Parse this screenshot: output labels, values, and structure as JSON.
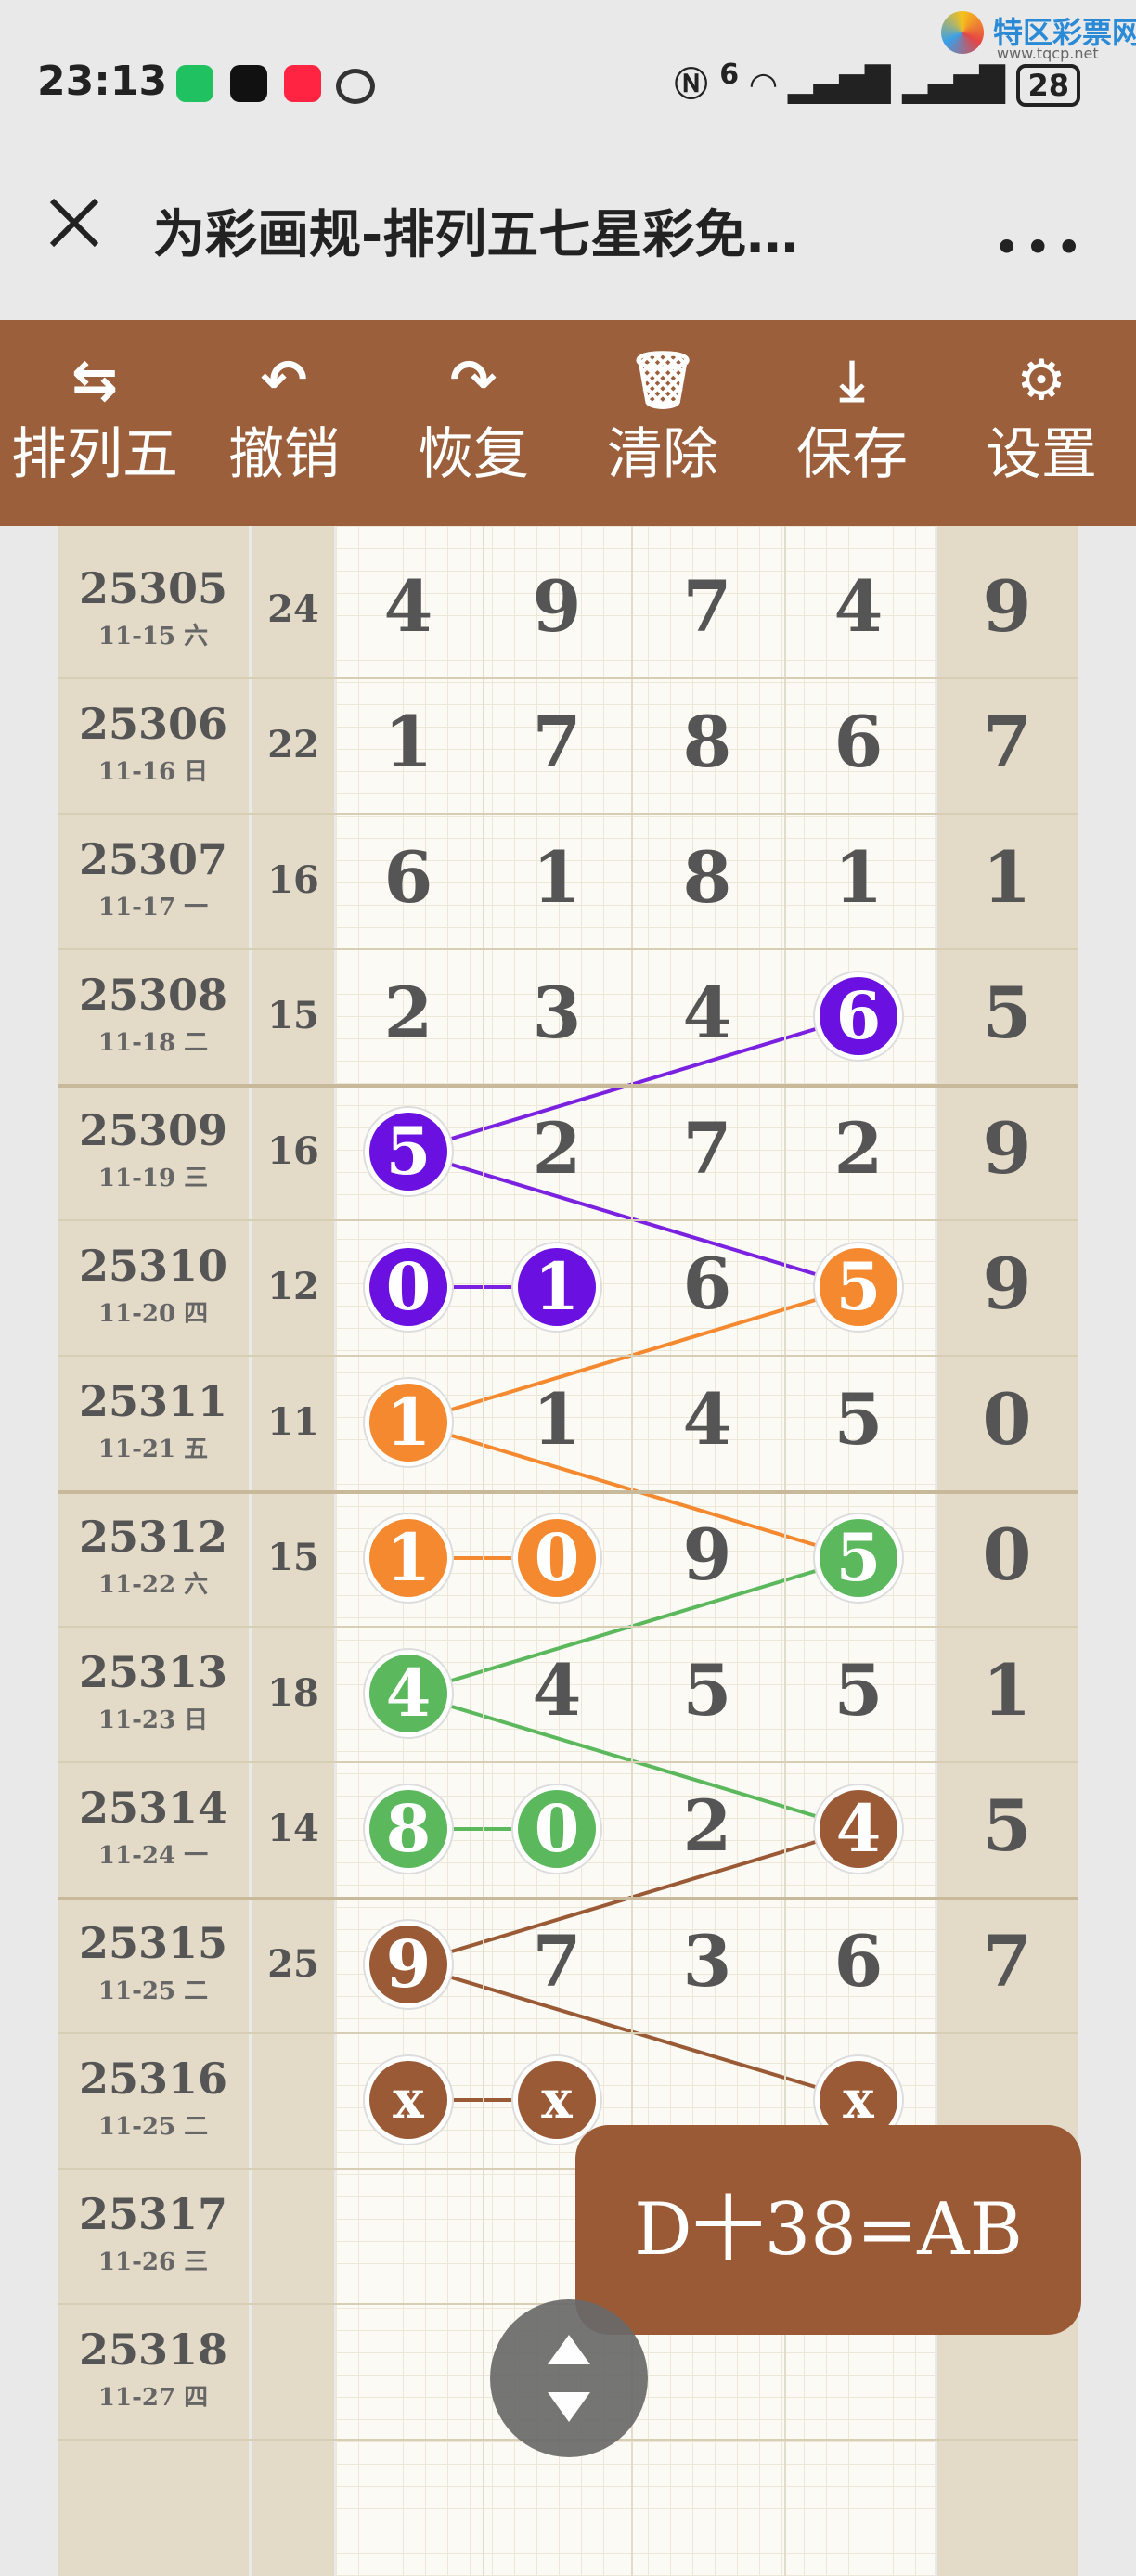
{
  "status": {
    "time": "23:13",
    "battery": "28",
    "network": "6"
  },
  "watermark": {
    "title": "特区彩票网",
    "url": "www.tqcp.net"
  },
  "header": {
    "title": "为彩画规-排列五七星彩免…",
    "more": "•••"
  },
  "toolbar": {
    "items": [
      {
        "label": "排列五",
        "icon": "swap-icon"
      },
      {
        "label": "撤销",
        "icon": "undo-icon"
      },
      {
        "label": "恢复",
        "icon": "redo-icon"
      },
      {
        "label": "清除",
        "icon": "trash-icon"
      },
      {
        "label": "保存",
        "icon": "download-icon"
      },
      {
        "label": "设置",
        "icon": "gear-icon"
      }
    ]
  },
  "rows": [
    {
      "issue": "25305",
      "date": "11-15 六",
      "sum": "24",
      "digits": [
        "4",
        "9",
        "7",
        "4"
      ],
      "tail": "9"
    },
    {
      "issue": "25306",
      "date": "11-16 日",
      "sum": "22",
      "digits": [
        "1",
        "7",
        "8",
        "6"
      ],
      "tail": "7"
    },
    {
      "issue": "25307",
      "date": "11-17 一",
      "sum": "16",
      "digits": [
        "6",
        "1",
        "8",
        "1"
      ],
      "tail": "1"
    },
    {
      "issue": "25308",
      "date": "11-18 二",
      "sum": "15",
      "digits": [
        "2",
        "3",
        "4",
        "6"
      ],
      "tail": "5"
    },
    {
      "issue": "25309",
      "date": "11-19 三",
      "sum": "16",
      "digits": [
        "5",
        "2",
        "7",
        "2"
      ],
      "tail": "9"
    },
    {
      "issue": "25310",
      "date": "11-20 四",
      "sum": "12",
      "digits": [
        "0",
        "1",
        "6",
        "5"
      ],
      "tail": "9"
    },
    {
      "issue": "25311",
      "date": "11-21 五",
      "sum": "11",
      "digits": [
        "1",
        "1",
        "4",
        "5"
      ],
      "tail": "0"
    },
    {
      "issue": "25312",
      "date": "11-22 六",
      "sum": "15",
      "digits": [
        "1",
        "0",
        "9",
        "5"
      ],
      "tail": "0"
    },
    {
      "issue": "25313",
      "date": "11-23 日",
      "sum": "18",
      "digits": [
        "4",
        "4",
        "5",
        "5"
      ],
      "tail": "1"
    },
    {
      "issue": "25314",
      "date": "11-24 一",
      "sum": "14",
      "digits": [
        "8",
        "0",
        "2",
        "4"
      ],
      "tail": "5"
    },
    {
      "issue": "25315",
      "date": "11-25 二",
      "sum": "25",
      "digits": [
        "9",
        "7",
        "3",
        "6"
      ],
      "tail": "7"
    },
    {
      "issue": "25316",
      "date": "11-25 二",
      "sum": "",
      "digits": [
        "x",
        "x",
        "",
        "x"
      ],
      "tail": ""
    },
    {
      "issue": "25317",
      "date": "11-26 三",
      "sum": "",
      "digits": [
        "",
        "",
        "",
        ""
      ],
      "tail": ""
    },
    {
      "issue": "25318",
      "date": "11-27 四",
      "sum": "",
      "digits": [
        "",
        "",
        "",
        ""
      ],
      "tail": ""
    }
  ],
  "marks": [
    {
      "row": 3,
      "col": 3,
      "color": "#6a10e0"
    },
    {
      "row": 4,
      "col": 0,
      "color": "#6a10e0"
    },
    {
      "row": 5,
      "col": 0,
      "color": "#6a10e0"
    },
    {
      "row": 5,
      "col": 1,
      "color": "#6a10e0"
    },
    {
      "row": 5,
      "col": 3,
      "color": "#f5892f"
    },
    {
      "row": 6,
      "col": 0,
      "color": "#f5892f"
    },
    {
      "row": 7,
      "col": 0,
      "color": "#f5892f"
    },
    {
      "row": 7,
      "col": 1,
      "color": "#f5892f"
    },
    {
      "row": 7,
      "col": 3,
      "color": "#5cb85c"
    },
    {
      "row": 8,
      "col": 0,
      "color": "#5cb85c"
    },
    {
      "row": 9,
      "col": 0,
      "color": "#5cb85c"
    },
    {
      "row": 9,
      "col": 1,
      "color": "#5cb85c"
    },
    {
      "row": 9,
      "col": 3,
      "color": "#9b5a36"
    },
    {
      "row": 10,
      "col": 0,
      "color": "#9b5a36"
    },
    {
      "row": 11,
      "col": 0,
      "color": "#9b5a36"
    },
    {
      "row": 11,
      "col": 1,
      "color": "#9b5a36"
    },
    {
      "row": 11,
      "col": 3,
      "color": "#9b5a36"
    }
  ],
  "links": [
    {
      "from": [
        3,
        3
      ],
      "to": [
        4,
        0
      ],
      "color": "#7a22e0"
    },
    {
      "from": [
        4,
        0
      ],
      "to": [
        5,
        3
      ],
      "color": "#7a22e0"
    },
    {
      "from": [
        5,
        0
      ],
      "to": [
        5,
        1
      ],
      "color": "#7a22e0"
    },
    {
      "from": [
        5,
        3
      ],
      "to": [
        6,
        0
      ],
      "color": "#f5892f"
    },
    {
      "from": [
        6,
        0
      ],
      "to": [
        7,
        3
      ],
      "color": "#f5892f"
    },
    {
      "from": [
        7,
        0
      ],
      "to": [
        7,
        1
      ],
      "color": "#f5892f"
    },
    {
      "from": [
        7,
        3
      ],
      "to": [
        8,
        0
      ],
      "color": "#5cb85c"
    },
    {
      "from": [
        8,
        0
      ],
      "to": [
        9,
        3
      ],
      "color": "#5cb85c"
    },
    {
      "from": [
        9,
        0
      ],
      "to": [
        9,
        1
      ],
      "color": "#5cb85c"
    },
    {
      "from": [
        9,
        3
      ],
      "to": [
        10,
        0
      ],
      "color": "#9b5a36"
    },
    {
      "from": [
        10,
        0
      ],
      "to": [
        11,
        3
      ],
      "color": "#9b5a36"
    },
    {
      "from": [
        11,
        0
      ],
      "to": [
        11,
        1
      ],
      "color": "#9b5a36"
    }
  ],
  "formula": "D十38=AB"
}
